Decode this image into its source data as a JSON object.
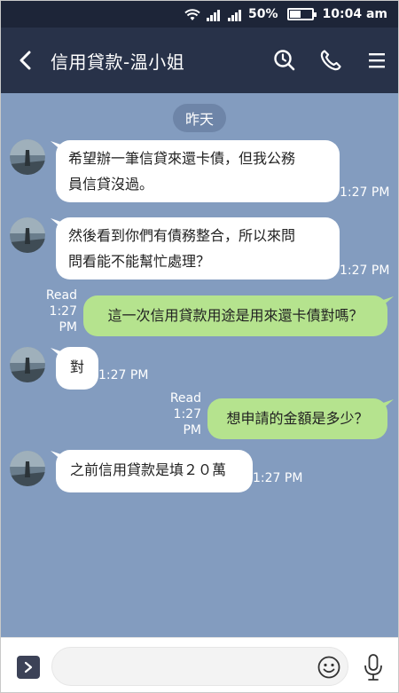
{
  "status_bar": {
    "battery_percent": "50%",
    "battery_level": 0.5,
    "time": "10:04 am",
    "icons": [
      "wifi-icon",
      "signal-icon",
      "signal-icon",
      "battery-icon"
    ]
  },
  "header": {
    "title": "信用貸款-溫小姐",
    "icons": [
      "back-arrow-icon",
      "search-icon",
      "phone-icon",
      "menu-icon"
    ]
  },
  "chat": {
    "date_label": "昨天",
    "messages": [
      {
        "direction": "in",
        "lines": [
          "希望辦一筆信貸來還卡債，但我公務",
          "員信貸沒過。"
        ],
        "time": "1:27 PM"
      },
      {
        "direction": "in",
        "lines": [
          "然後看到你們有債務整合，所以來問",
          "問看能不能幫忙處理？"
        ],
        "time": "1:27 PM"
      },
      {
        "direction": "out",
        "lines": [
          "這一次信用貸款用途是用來還卡債對嗎？"
        ],
        "read": "Read",
        "time_parts": [
          "1:27",
          "PM"
        ]
      },
      {
        "direction": "in",
        "lines": [
          "對"
        ],
        "time": "1:27 PM"
      },
      {
        "direction": "out",
        "lines": [
          "想申請的金額是多少？"
        ],
        "read": "Read",
        "time_parts": [
          "1:27",
          "PM"
        ]
      },
      {
        "direction": "in",
        "lines": [
          "之前信用貸款是填２０萬"
        ],
        "time": "1:27 PM"
      }
    ]
  },
  "input_bar": {
    "placeholder": "",
    "value": "",
    "icons": [
      "expand-icon",
      "emoji-icon",
      "microphone-icon"
    ]
  },
  "colors": {
    "header_bg": "#283249",
    "status_bg": "#1d2538",
    "chat_bg": "#839cbf",
    "outgoing_bubble": "#b5e38e",
    "incoming_bubble": "#ffffff"
  }
}
